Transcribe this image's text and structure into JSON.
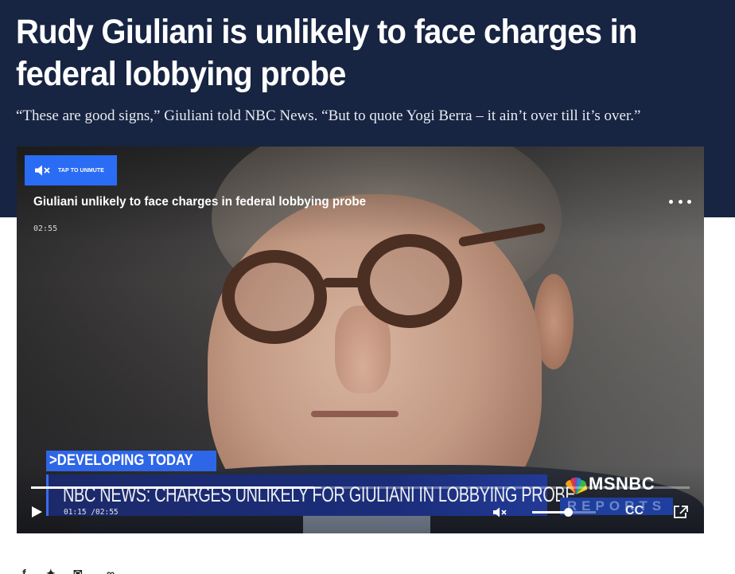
{
  "article": {
    "headline": "Rudy Giuliani is unlikely to face charges in federal lobbying probe",
    "dek": "“These are good signs,” Giuliani told NBC News. “But to quote Yogi Berra – it ain’t over till it’s over.”"
  },
  "video": {
    "unmute_label": "TAP TO UNMUTE",
    "title": "Giuliani unlikely to face charges in federal lobbying probe",
    "duration": "02:55",
    "more_icon": "more-horizontal-icon",
    "lower_third": {
      "kicker": ">DEVELOPING TODAY",
      "headline": "NBC NEWS: CHARGES UNLIKELY FOR GIULIANI IN LOBBYING PROBE"
    },
    "network_bug": {
      "brand": "MSNBC",
      "show": "REPORTS"
    },
    "controls": {
      "timecode": "01:15 /02:55",
      "progress_fraction": 0.43,
      "volume_fraction": 0.56,
      "cc_label": "CC",
      "icons": [
        "play-icon",
        "volume-muted-icon",
        "popout-icon"
      ]
    }
  },
  "share": {
    "icons": [
      "facebook-icon",
      "twitter-icon",
      "email-icon",
      "link-icon"
    ]
  },
  "colors": {
    "header_bg": "#172442",
    "accent_blue": "#2a6cf4",
    "lower_third_blue": "#1c2a6b"
  }
}
